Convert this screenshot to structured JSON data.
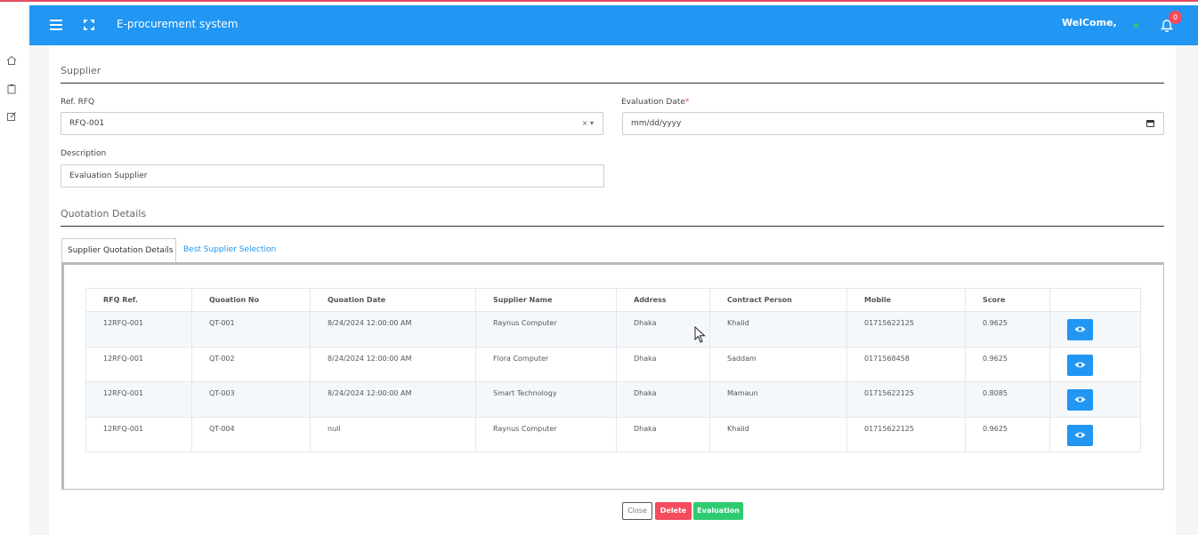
{
  "header": {
    "app_title": "E-procurement system",
    "welcome": "WelCome,",
    "notification_count": "0"
  },
  "sidebar": {
    "icons": [
      "home-icon",
      "clipboard-icon",
      "edit-icon"
    ]
  },
  "form": {
    "section_title": "Supplier",
    "ref_rfq_label": "Ref. RFQ",
    "ref_rfq_value": "RFQ-001",
    "ref_rfq_controls": "× ▾",
    "eval_date_label": "Evaluation Date",
    "eval_date_required": "*",
    "eval_date_placeholder": "mm/dd/yyyy",
    "description_label": "Description",
    "description_value": "Evaluation Supplier"
  },
  "quotation": {
    "section_title": "Quotation Details",
    "tabs": [
      "Supplier Quotation Details",
      "Best Supplier Selection"
    ],
    "columns": [
      "RFQ Ref.",
      "Quoation No",
      "Quoation Date",
      "Supplier Name",
      "Address",
      "Contract Person",
      "Mobile",
      "Score",
      ""
    ],
    "rows": [
      [
        "12RFQ-001",
        "QT-001",
        "8/24/2024 12:00:00 AM",
        "Raynus Computer",
        "Dhaka",
        "Khalid",
        "01715622125",
        "0.9625"
      ],
      [
        "12RFQ-001",
        "QT-002",
        "8/24/2024 12:00:00 AM",
        "Flora Computer",
        "Dhaka",
        "Saddam",
        "0171568458",
        "0.9625"
      ],
      [
        "12RFQ-001",
        "QT-003",
        "8/24/2024 12:00:00 AM",
        "Smart Technology",
        "Dhaka",
        "Mamaun",
        "01715622125",
        "0.8085"
      ],
      [
        "12RFQ-001",
        "QT-004",
        "null",
        "Raynus Computer",
        "Dhaka",
        "Khalid",
        "01715622125",
        "0.9625"
      ]
    ]
  },
  "actions": {
    "close": "Close",
    "delete": "Delete",
    "evaluation": "Evaluation"
  },
  "colors": {
    "header": "#2196f3",
    "danger": "#f44b5d",
    "success": "#2ecc71",
    "link": "#2196f3"
  }
}
